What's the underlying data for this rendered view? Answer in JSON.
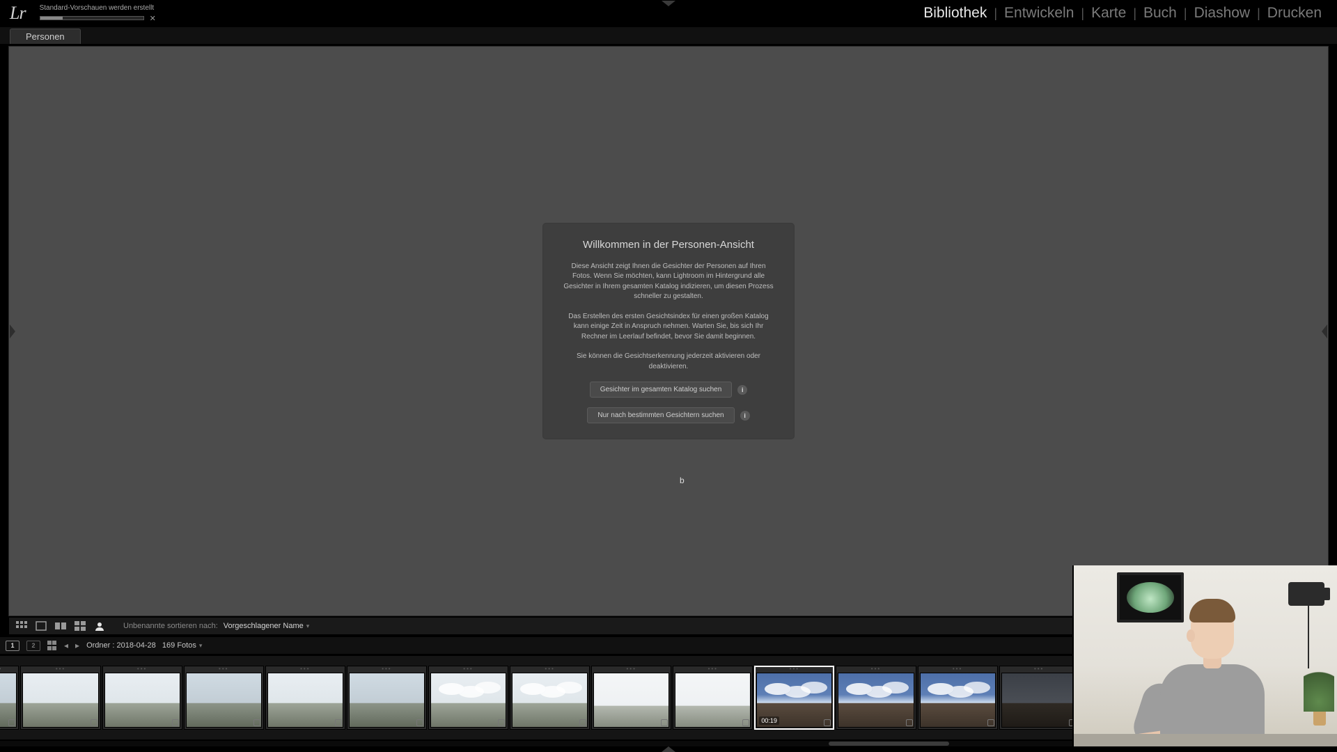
{
  "activity": {
    "label": "Standard-Vorschauen werden erstellt"
  },
  "modules": {
    "items": [
      "Bibliothek",
      "Entwickeln",
      "Karte",
      "Buch",
      "Diashow",
      "Drucken"
    ],
    "active": 0
  },
  "tab": {
    "label": "Personen"
  },
  "dialog": {
    "title": "Willkommen in der Personen-Ansicht",
    "p1": "Diese Ansicht zeigt Ihnen die Gesichter der Personen auf Ihren Fotos. Wenn Sie möchten, kann Lightroom im Hintergrund alle Gesichter in Ihrem gesamten Katalog indizieren, um diesen Prozess schneller zu gestalten.",
    "p2": "Das Erstellen des ersten Gesichtsindex für einen großen Katalog kann einige Zeit in Anspruch nehmen. Warten Sie, bis sich Ihr Rechner im Leerlauf befindet, bevor Sie damit beginnen.",
    "p3": "Sie können die Gesichtserkennung jederzeit aktivieren oder deaktivieren.",
    "btn1": "Gesichter im gesamten Katalog suchen",
    "btn2": "Nur nach bestimmten Gesichtern suchen"
  },
  "lowerbar": {
    "sort_label": "Unbenannte sortieren nach:",
    "sort_value": "Vorgeschlagener Name"
  },
  "filmstrip_header": {
    "monitor1": "1",
    "monitor2": "2",
    "breadcrumb": "Ordner : 2018-04-28",
    "count": "169 Fotos"
  },
  "filmstrip": {
    "items": [
      {
        "style": "sky-mid",
        "selected": false,
        "half": true
      },
      {
        "style": "sky-light",
        "selected": false
      },
      {
        "style": "sky-light",
        "selected": false
      },
      {
        "style": "sky-mid",
        "selected": false
      },
      {
        "style": "sky-light",
        "selected": false
      },
      {
        "style": "sky-mid",
        "selected": false
      },
      {
        "style": "sky-light clouds",
        "selected": false
      },
      {
        "style": "sky-light clouds",
        "selected": false
      },
      {
        "style": "sky-white",
        "selected": false
      },
      {
        "style": "sky-white",
        "selected": false
      },
      {
        "style": "sky-blue clouds",
        "selected": true,
        "timestamp": "00:19"
      },
      {
        "style": "sky-blue clouds",
        "selected": false
      },
      {
        "style": "sky-blue clouds",
        "selected": false
      },
      {
        "style": "sky-dark",
        "selected": false
      },
      {
        "style": "sky-dark",
        "selected": false
      },
      {
        "style": "sky-dark",
        "selected": false
      },
      {
        "style": "sky-dark",
        "selected": false
      }
    ]
  },
  "cursor_text": "b"
}
